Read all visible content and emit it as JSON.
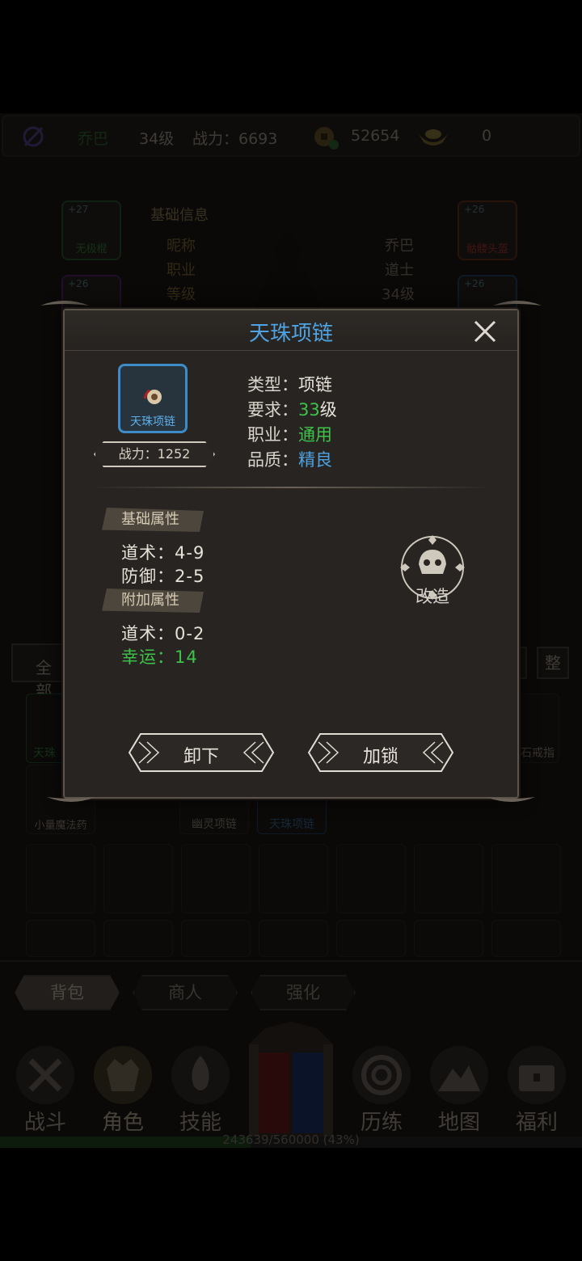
{
  "topbar": {
    "name": "乔巴",
    "level": "34级",
    "power": "战力：6693",
    "coins": "52654",
    "gold": "0"
  },
  "equip_slots": {
    "left_top": {
      "level": "+27",
      "name": "无极棍"
    },
    "left_second": {
      "level": "+26"
    },
    "right_top": {
      "level": "+26",
      "name": "骷髅头盔"
    },
    "right_second": {
      "level": "+26"
    }
  },
  "basic_info": {
    "title": "基础信息",
    "rows": [
      {
        "label": "昵称",
        "value": "乔巴"
      },
      {
        "label": "职业",
        "value": "道士"
      },
      {
        "label": "等级",
        "value": "34级"
      }
    ]
  },
  "filter": {
    "all": "全部",
    "sort": "整"
  },
  "bag_items": {
    "row1": [
      "天珠",
      "石戒指"
    ],
    "row2": [
      "小量魔法药",
      "幽灵项链",
      "天珠项链"
    ]
  },
  "tabs": [
    "背包",
    "商人",
    "强化"
  ],
  "nav": [
    "战斗",
    "角色",
    "技能",
    "历练",
    "地图",
    "福利"
  ],
  "xp": {
    "text": "243639/560000 (43%)",
    "fraction": 0.43
  },
  "modal": {
    "title": "天珠项链",
    "item_name": "天珠项链",
    "power": "战力：1252",
    "props": {
      "type_label": "类型：",
      "type_value": "项链",
      "req_label": "要求：",
      "req_num": "33",
      "req_unit": "级",
      "job_label": "职业：",
      "job_value": "通用",
      "quality_label": "品质：",
      "quality_value": "精良"
    },
    "base_section": "基础属性",
    "base_attrs": [
      {
        "label": "道术：",
        "value": "4-9"
      },
      {
        "label": "防御：",
        "value": "2-5"
      }
    ],
    "extra_section": "附加属性",
    "extra_attrs": [
      {
        "label": "道术：",
        "value": "0-2"
      },
      {
        "label": "幸运：",
        "value": "14"
      }
    ],
    "modify_label": "改造",
    "unequip_label": "卸下",
    "lock_label": "加锁"
  },
  "colors": {
    "title_blue": "#4fa3e2",
    "green": "#3fc24a",
    "panel": "#272421"
  }
}
